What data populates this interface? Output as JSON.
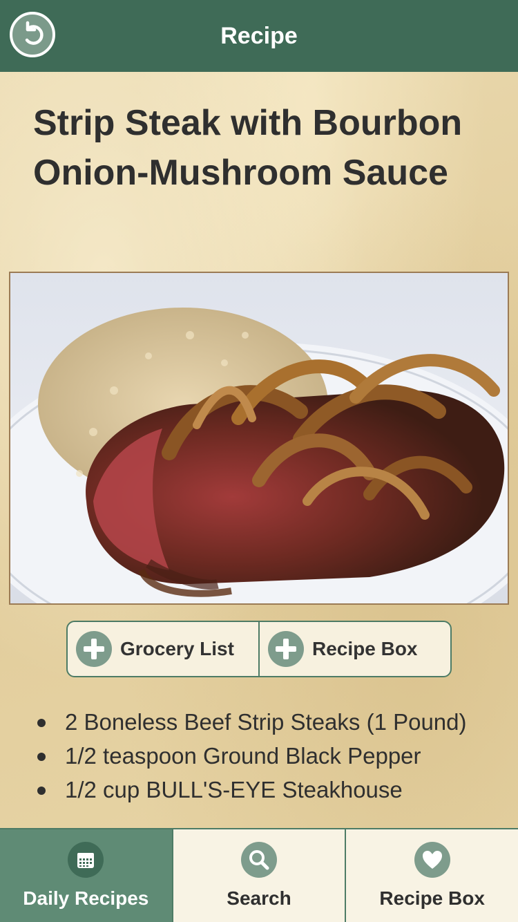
{
  "header": {
    "title": "Recipe",
    "back_icon": "back-arrow-icon"
  },
  "recipe": {
    "title": "Strip Steak with Bourbon Onion-Mushroom Sauce",
    "photo_subject": "food-photo"
  },
  "actions": [
    {
      "label": "Grocery List",
      "icon": "plus-icon"
    },
    {
      "label": "Recipe Box",
      "icon": "plus-icon"
    }
  ],
  "ingredients": [
    "2 Boneless Beef Strip Steaks (1 Pound)",
    "1/2 teaspoon Ground Black Pepper",
    "1/2 cup BULL'S-EYE Steakhouse"
  ],
  "tabs": [
    {
      "label": "Daily Recipes",
      "icon": "calendar-icon",
      "active": true
    },
    {
      "label": "Search",
      "icon": "search-icon",
      "active": false
    },
    {
      "label": "Recipe Box",
      "icon": "heart-icon",
      "active": false
    }
  ],
  "colors": {
    "header": "#3f6b57",
    "accent": "#4d7b65",
    "active_tab": "#5f8b75",
    "icon_circle": "#7e9c8c",
    "parchment": "#e6d4a6"
  }
}
